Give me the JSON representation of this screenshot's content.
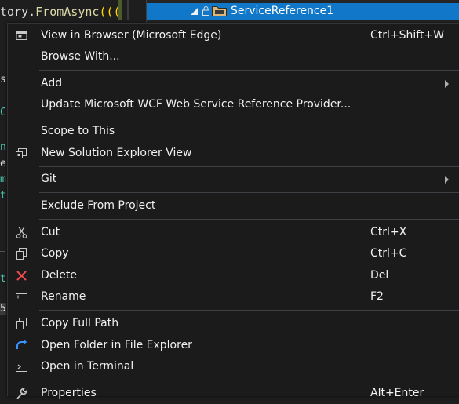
{
  "editor": {
    "code_prefix": "tory.",
    "code_function": "FromAsync",
    "code_suffix": "((("
  },
  "solution_explorer": {
    "selected_node": "ServiceReference1"
  },
  "context_menu": {
    "items": [
      {
        "label": "View in Browser (Microsoft Edge)",
        "shortcut": "Ctrl+Shift+W",
        "icon": "browser-window-icon"
      },
      {
        "label": "Browse With...",
        "shortcut": ""
      },
      {
        "label": "Add",
        "submenu": true
      },
      {
        "label": "Update Microsoft WCF Web Service Reference Provider...",
        "shortcut": ""
      },
      {
        "label": "Scope to This",
        "shortcut": ""
      },
      {
        "label": "New Solution Explorer View",
        "shortcut": "",
        "icon": "new-solution-explorer-view-icon"
      },
      {
        "label": "Git",
        "submenu": true
      },
      {
        "label": "Exclude From Project",
        "shortcut": ""
      },
      {
        "label": "Cut",
        "shortcut": "Ctrl+X",
        "icon": "scissors-icon"
      },
      {
        "label": "Copy",
        "shortcut": "Ctrl+C",
        "icon": "copy-icon"
      },
      {
        "label": "Delete",
        "shortcut": "Del",
        "icon": "delete-x-icon"
      },
      {
        "label": "Rename",
        "shortcut": "F2",
        "icon": "rename-icon"
      },
      {
        "label": "Copy Full Path",
        "shortcut": "",
        "icon": "copy-full-path-icon"
      },
      {
        "label": "Open Folder in File Explorer",
        "shortcut": "",
        "icon": "open-folder-arrow-icon"
      },
      {
        "label": "Open in Terminal",
        "shortcut": "",
        "icon": "terminal-icon"
      },
      {
        "label": "Properties",
        "shortcut": "Alt+Enter",
        "icon": "wrench-icon"
      }
    ]
  },
  "colors": {
    "menu_background": "#1b1b1c",
    "menu_text": "#f1f1f1",
    "selection_blue": "#1177c9",
    "delete_red": "#f14c4c",
    "folder_orange": "#dcb67a"
  }
}
